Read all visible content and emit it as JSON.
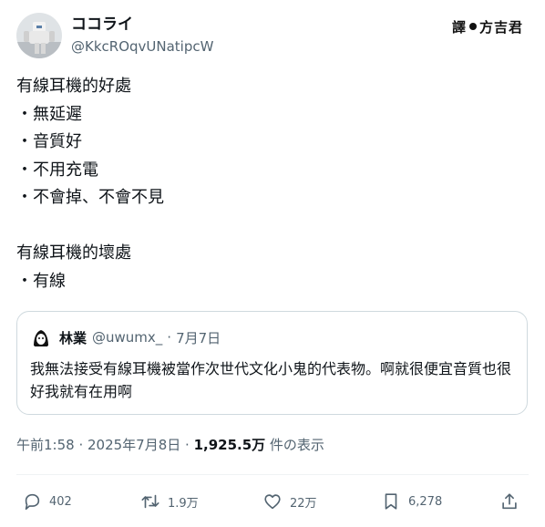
{
  "user": {
    "display_name": "ココライ",
    "handle": "@KkcROqvUNatipcW",
    "avatar": "robot-avatar"
  },
  "watermark": {
    "part1": "譯",
    "part2": "方吉君"
  },
  "tweet": {
    "lines": [
      "有線耳機的好處",
      "・無延遲",
      "・音質好",
      "・不用充電",
      "・不會掉、不會不見",
      "",
      "有線耳機的壞處",
      "・有線"
    ]
  },
  "quote": {
    "name": "林業",
    "handle": "@uwumx_",
    "separator": "·",
    "date": "7月7日",
    "text": "我無法接受有線耳機被當作次世代文化小鬼的代表物。啊就很便宜音質也很好我就有在用啊"
  },
  "meta": {
    "time": "午前1:58 · 2025年7月8日 · ",
    "views": "1,925.5万",
    "views_label": " 件の表示"
  },
  "actions": {
    "replies": "402",
    "reposts": "1.9万",
    "likes": "22万",
    "bookmarks": "6,278"
  }
}
